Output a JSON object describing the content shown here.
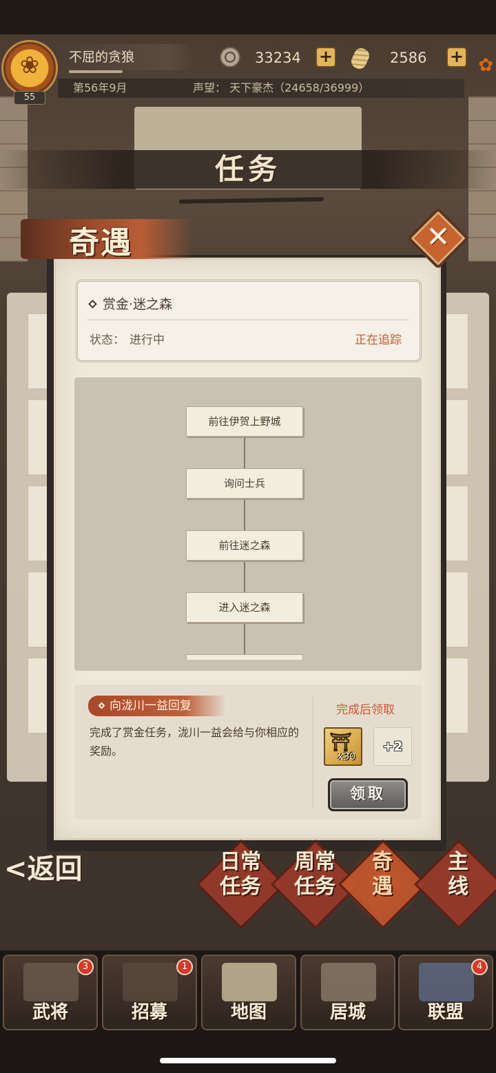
{
  "header": {
    "player_name": "不屈的贪狼",
    "level": "55",
    "coins": "33234",
    "food": "2586",
    "date": "第56年9月",
    "prestige": "声望：  天下豪杰（24658/36999）"
  },
  "page": {
    "title": "任务"
  },
  "modal": {
    "title": "奇遇",
    "close_icon": "close-icon",
    "quest": {
      "name": "赏金·迷之森",
      "status_label": "状态：",
      "status_value": "进行中",
      "tracking": "正在追踪"
    },
    "steps": [
      "前往伊贺上野城",
      "询问士兵",
      "前往迷之森",
      "进入迷之森"
    ],
    "reward": {
      "tag": "向泷川一益回复",
      "description": "完成了赏金任务，泷川一益会给与你相应的奖励。",
      "after_label": "完成后领取",
      "items": [
        {
          "icon": "gold-torii-icon",
          "count": "x30"
        },
        {
          "icon": "more-items-icon",
          "count": "+2"
        }
      ],
      "claim_label": "领取"
    }
  },
  "tabs": {
    "back": "<返回",
    "items": [
      {
        "label": "日常\n任务"
      },
      {
        "label": "周常\n任务"
      },
      {
        "label": "奇\n遇"
      },
      {
        "label": "主\n线"
      }
    ]
  },
  "nav": {
    "items": [
      {
        "label": "武将",
        "badge": "3"
      },
      {
        "label": "招募",
        "badge": "1"
      },
      {
        "label": "地图",
        "badge": ""
      },
      {
        "label": "居城",
        "badge": ""
      },
      {
        "label": "联盟",
        "badge": "4"
      }
    ]
  },
  "colors": {
    "accent_red": "#c85a32",
    "tab_red": "#9a3a2a",
    "gold": "#e2b45b"
  }
}
